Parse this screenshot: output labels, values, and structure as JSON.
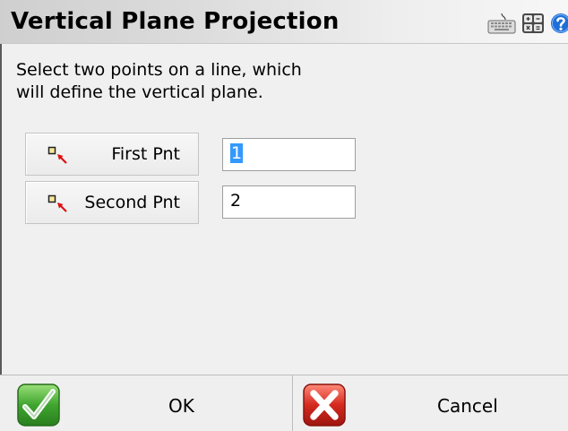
{
  "window": {
    "title": "Vertical Plane Projection",
    "toolbar_icons": [
      "keyboard-icon",
      "calculator-icon",
      "help-icon"
    ]
  },
  "instructions": {
    "line1": "Select two points on a line, which",
    "line2": "will define the vertical plane."
  },
  "points": [
    {
      "button_label": "First Pnt",
      "value": "1",
      "selected": true
    },
    {
      "button_label": "Second Pnt",
      "value": "2",
      "selected": false
    }
  ],
  "footer": {
    "ok_label": "OK",
    "cancel_label": "Cancel"
  },
  "colors": {
    "ok_green": "#3a9a2a",
    "cancel_red": "#cc2222",
    "selection_blue": "#3399ff",
    "help_blue": "#1e6fd9"
  }
}
